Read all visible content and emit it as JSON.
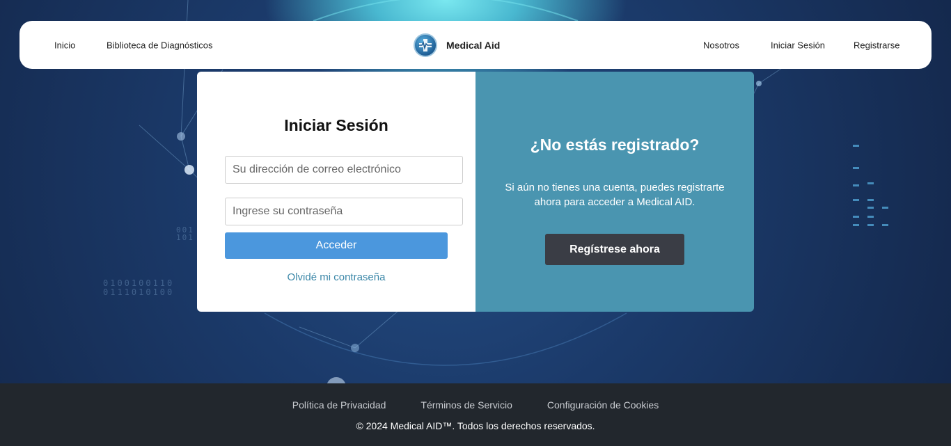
{
  "nav": {
    "left_links": [
      "Inicio",
      "Biblioteca de Diagnósticos"
    ],
    "brand": "Medical Aid",
    "right_links": [
      "Nosotros",
      "Iniciar Sesión",
      "Registrarse"
    ]
  },
  "login": {
    "title": "Iniciar Sesión",
    "email_placeholder": "Su dirección de correo electrónico",
    "password_placeholder": "Ingrese su contraseña",
    "submit_label": "Acceder",
    "forgot_label": "Olvidé mi contraseña"
  },
  "register": {
    "title": "¿No estás registrado?",
    "text": "Si aún no tienes una cuenta, puedes registrarte ahora para acceder a Medical AID.",
    "button_label": "Regístrese ahora"
  },
  "background": {
    "binary_left": [
      "0100100110",
      "0111010100"
    ],
    "binary_small": [
      "001",
      "101"
    ]
  },
  "footer": {
    "links": [
      "Política de Privacidad",
      "Términos de Servicio",
      "Configuración de Cookies"
    ],
    "copyright": "© 2024 Medical AID™. Todos los derechos reservados."
  },
  "colors": {
    "login_button": "#4b97dd",
    "register_panel": "#4a95b0",
    "register_button": "#3a3d45",
    "footer": "#22272d"
  }
}
